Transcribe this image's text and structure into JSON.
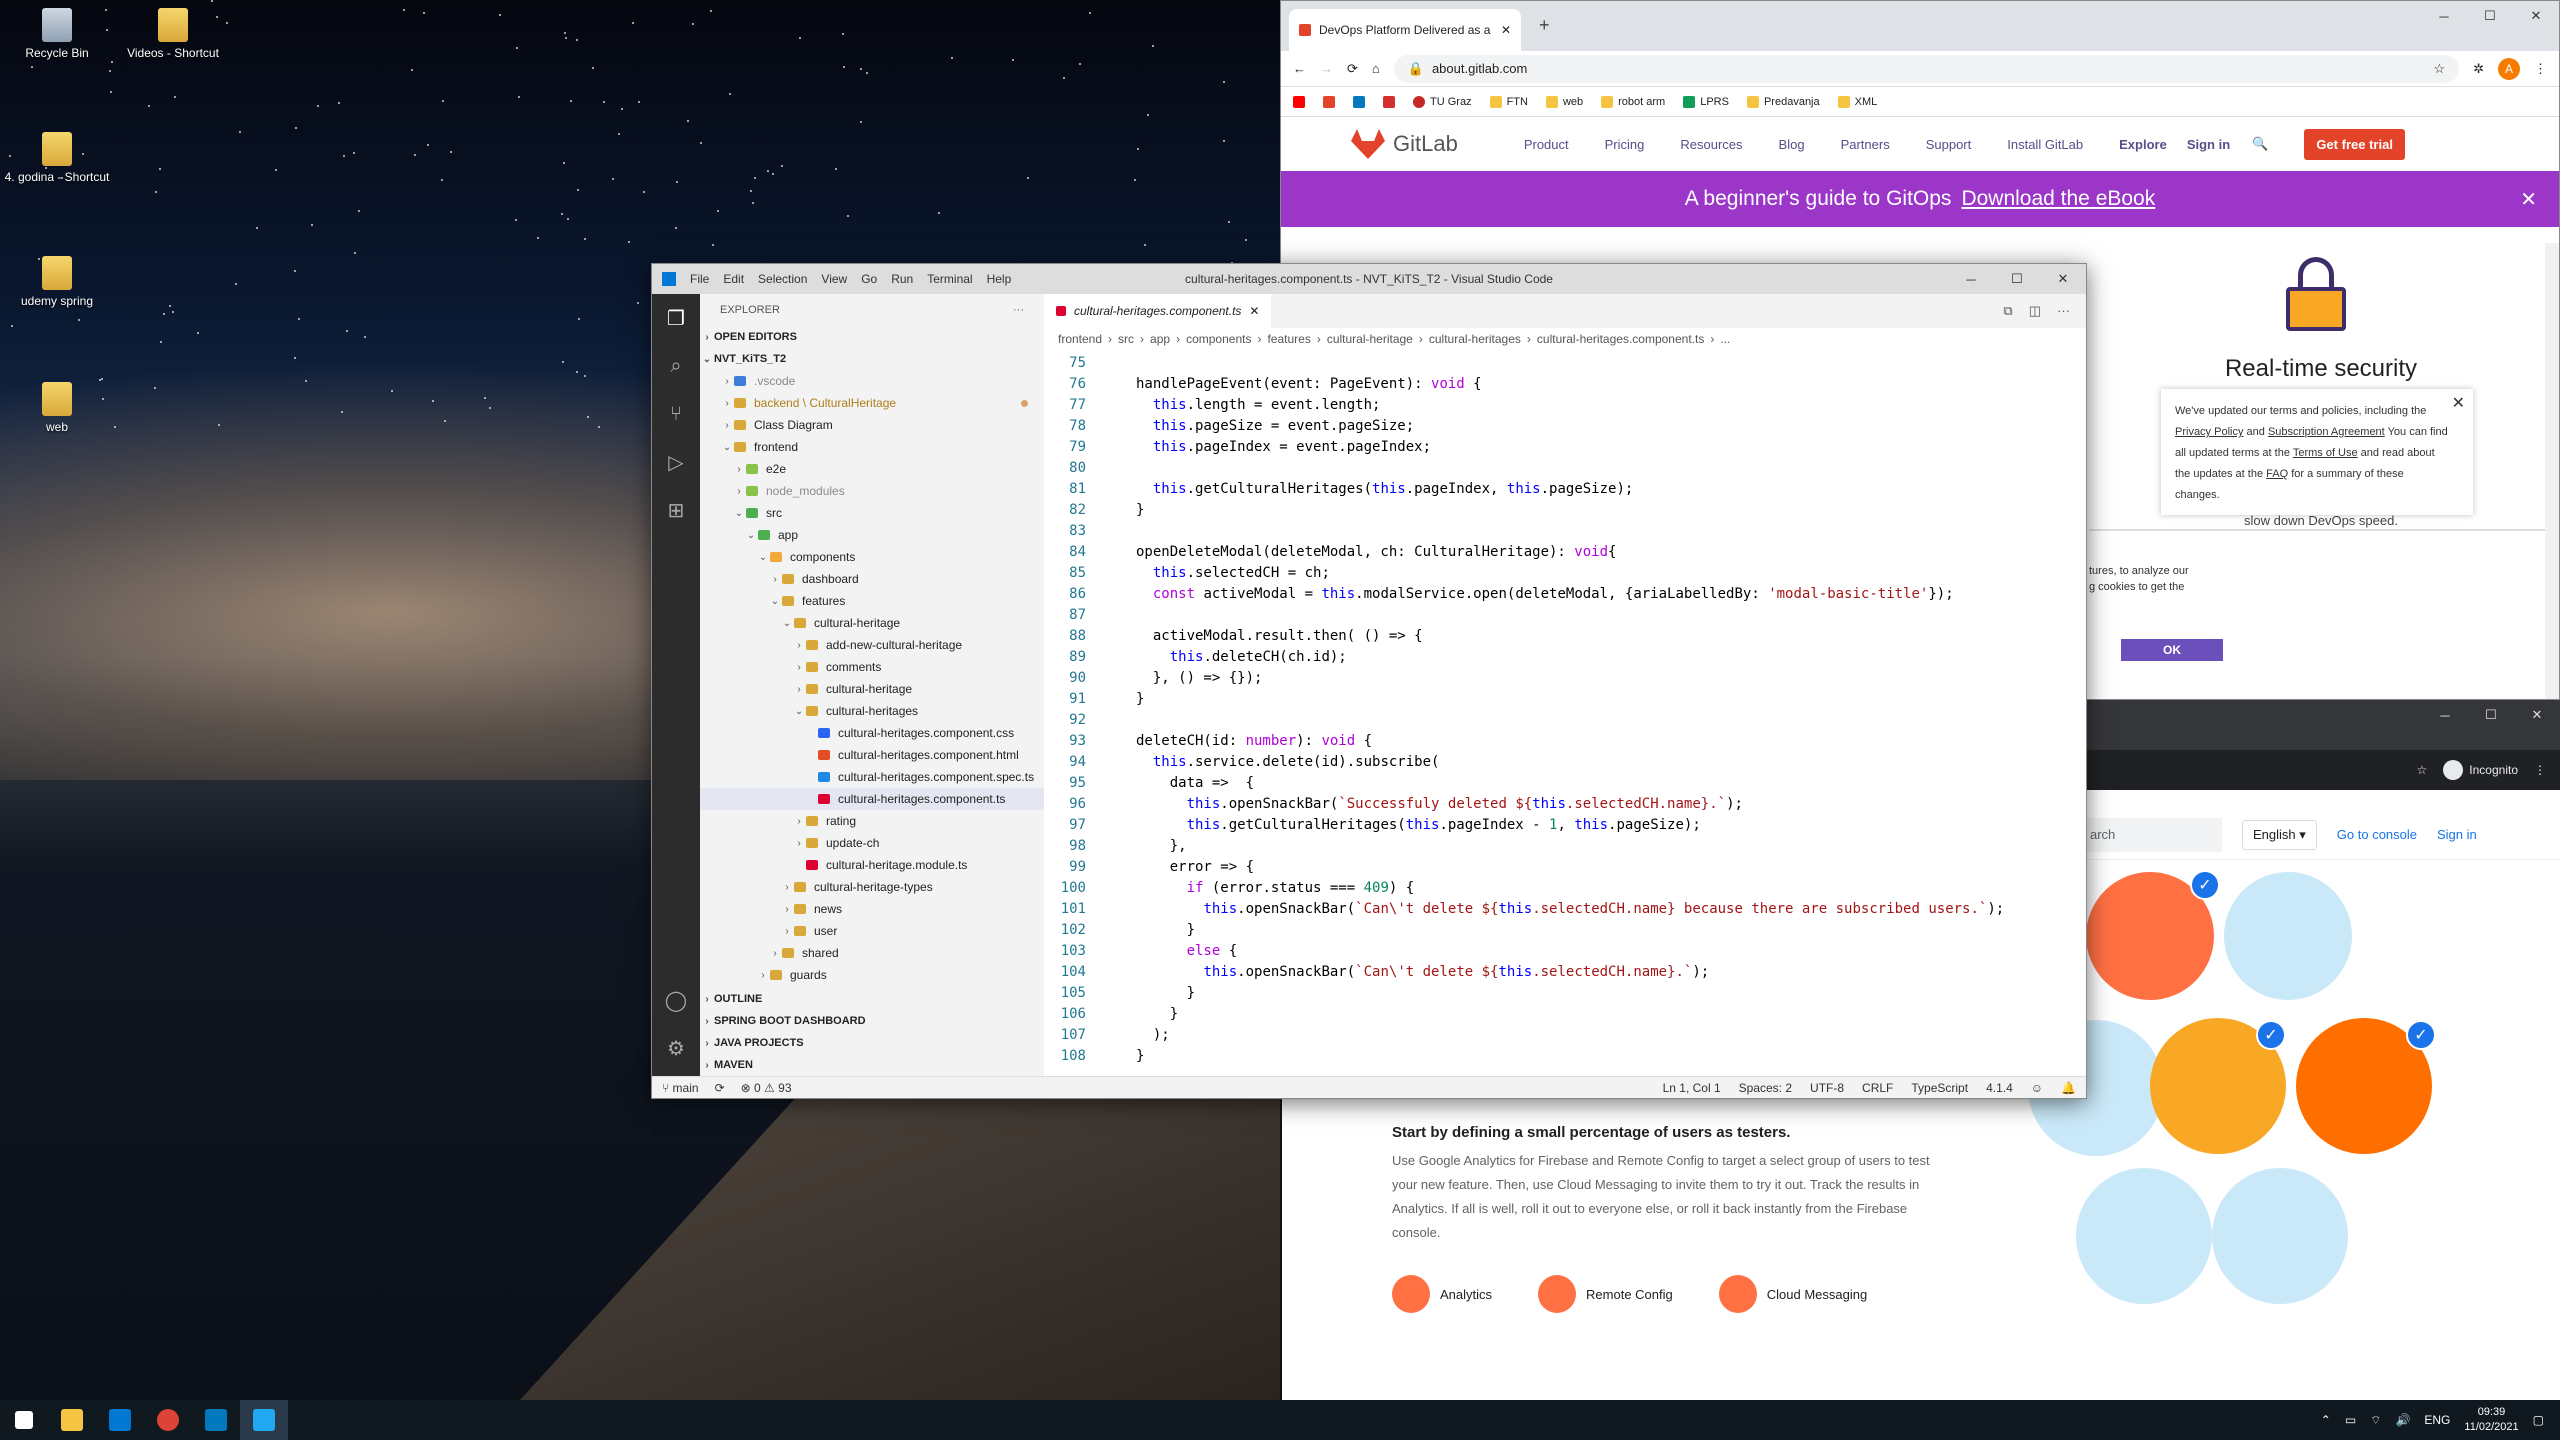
{
  "desktop": {
    "icons": [
      {
        "label": "Recycle Bin"
      },
      {
        "label": "Videos - Shortcut"
      },
      {
        "label": "4. godina - Shortcut"
      },
      {
        "label": "udemy spring"
      },
      {
        "label": "web"
      }
    ]
  },
  "gitlab_browser": {
    "tab_title": "DevOps Platform Delivered as a",
    "url": "about.gitlab.com",
    "bookmarks": [
      "TU Graz",
      "FTN",
      "web",
      "robot arm",
      "LPRS",
      "Predavanja",
      "XML"
    ],
    "profile_initial": "A",
    "nav": {
      "logo": "GitLab",
      "items": [
        "Product",
        "Pricing",
        "Resources",
        "Blog",
        "Partners",
        "Support",
        "Install GitLab",
        "Explore",
        "Sign in"
      ],
      "cta": "Get free trial"
    },
    "banner": {
      "text": "A beginner's guide to GitOps",
      "link": "Download the eBook"
    },
    "feature_title": "Real-time security",
    "cookie": {
      "p1": "We've updated our terms and policies, including the ",
      "privacy": "Privacy Policy",
      "and": " and ",
      "sub": "Subscription Agreement",
      "p2": " You can find all updated terms at the ",
      "terms": "Terms of Use",
      "p3": " and read about the updates at the ",
      "faq": "FAQ",
      "p4": " for a summary of these changes."
    },
    "partial": "slow down DevOps speed.",
    "consent_text1": "tures, to analyze our",
    "consent_text2": "g cookies to get the",
    "ok": "OK"
  },
  "firebase_browser": {
    "incognito": "Incognito",
    "search_placeholder": "arch",
    "language": "English",
    "console": "Go to console",
    "signin": "Sign in",
    "heading": "Start by defining a small percentage of users as testers.",
    "body": "Use Google Analytics for Firebase and Remote Config to target a select group of users to test your new feature. Then, use Cloud Messaging to invite them to try it out. Track the results in Analytics. If all is well, roll it out to everyone else, or roll it back instantly from the Firebase console.",
    "features": [
      "Analytics",
      "Remote Config",
      "Cloud Messaging"
    ]
  },
  "vscode": {
    "menu": [
      "File",
      "Edit",
      "Selection",
      "View",
      "Go",
      "Run",
      "Terminal",
      "Help"
    ],
    "title": "cultural-heritages.component.ts - NVT_KiTS_T2 - Visual Studio Code",
    "explorer_label": "EXPLORER",
    "open_editors": "OPEN EDITORS",
    "project": "NVT_KiTS_T2",
    "tree": [
      {
        "label": ".vscode",
        "depth": 1,
        "icon": "#3b7dd8",
        "chev": ">",
        "dim": true
      },
      {
        "label": "backend \\ CulturalHeritage",
        "depth": 1,
        "icon": "#d9a83a",
        "chev": ">",
        "mod": true
      },
      {
        "label": "Class Diagram",
        "depth": 1,
        "icon": "#d9a83a",
        "chev": ">"
      },
      {
        "label": "frontend",
        "depth": 1,
        "icon": "#d9a83a",
        "chev": "v"
      },
      {
        "label": "e2e",
        "depth": 2,
        "icon": "#8bc34a",
        "chev": ">"
      },
      {
        "label": "node_modules",
        "depth": 2,
        "icon": "#8bc34a",
        "chev": ">",
        "dim": true
      },
      {
        "label": "src",
        "depth": 2,
        "icon": "#4caf50",
        "chev": "v"
      },
      {
        "label": "app",
        "depth": 3,
        "icon": "#4caf50",
        "chev": "v"
      },
      {
        "label": "components",
        "depth": 4,
        "icon": "#f2a93b",
        "chev": "v"
      },
      {
        "label": "dashboard",
        "depth": 5,
        "icon": "#d9a83a",
        "chev": ">"
      },
      {
        "label": "features",
        "depth": 5,
        "icon": "#d9a83a",
        "chev": "v"
      },
      {
        "label": "cultural-heritage",
        "depth": 6,
        "icon": "#d9a83a",
        "chev": "v"
      },
      {
        "label": "add-new-cultural-heritage",
        "depth": 7,
        "icon": "#d9a83a",
        "chev": ">"
      },
      {
        "label": "comments",
        "depth": 7,
        "icon": "#d9a83a",
        "chev": ">"
      },
      {
        "label": "cultural-heritage",
        "depth": 7,
        "icon": "#d9a83a",
        "chev": ">"
      },
      {
        "label": "cultural-heritages",
        "depth": 7,
        "icon": "#d9a83a",
        "chev": "v"
      },
      {
        "label": "cultural-heritages.component.css",
        "depth": 8,
        "icon": "#2965f1",
        "chev": ""
      },
      {
        "label": "cultural-heritages.component.html",
        "depth": 8,
        "icon": "#e44d26",
        "chev": ""
      },
      {
        "label": "cultural-heritages.component.spec.ts",
        "depth": 8,
        "icon": "#1e88e5",
        "chev": ""
      },
      {
        "label": "cultural-heritages.component.ts",
        "depth": 8,
        "icon": "#dd0031",
        "chev": "",
        "sel": true
      },
      {
        "label": "rating",
        "depth": 7,
        "icon": "#d9a83a",
        "chev": ">"
      },
      {
        "label": "update-ch",
        "depth": 7,
        "icon": "#d9a83a",
        "chev": ">"
      },
      {
        "label": "cultural-heritage.module.ts",
        "depth": 7,
        "icon": "#dd0031",
        "chev": ""
      },
      {
        "label": "cultural-heritage-types",
        "depth": 6,
        "icon": "#d9a83a",
        "chev": ">"
      },
      {
        "label": "news",
        "depth": 6,
        "icon": "#d9a83a",
        "chev": ">"
      },
      {
        "label": "user",
        "depth": 6,
        "icon": "#d9a83a",
        "chev": ">"
      },
      {
        "label": "shared",
        "depth": 5,
        "icon": "#d9a83a",
        "chev": ">"
      },
      {
        "label": "guards",
        "depth": 4,
        "icon": "#d9a83a",
        "chev": ">"
      }
    ],
    "sections": [
      "OUTLINE",
      "SPRING BOOT DASHBOARD",
      "JAVA PROJECTS",
      "MAVEN"
    ],
    "tab": "cultural-heritages.component.ts",
    "breadcrumb": [
      "frontend",
      "src",
      "app",
      "components",
      "features",
      "cultural-heritage",
      "cultural-heritages",
      "cultural-heritages.component.ts",
      "..."
    ],
    "code": [
      {
        "n": "75",
        "t": ""
      },
      {
        "n": "76",
        "t": "handlePageEvent(event: PageEvent): void {"
      },
      {
        "n": "77",
        "t": "  this.length = event.length;"
      },
      {
        "n": "78",
        "t": "  this.pageSize = event.pageSize;"
      },
      {
        "n": "79",
        "t": "  this.pageIndex = event.pageIndex;"
      },
      {
        "n": "80",
        "t": ""
      },
      {
        "n": "81",
        "t": "  this.getCulturalHeritages(this.pageIndex, this.pageSize);"
      },
      {
        "n": "82",
        "t": "}"
      },
      {
        "n": "83",
        "t": ""
      },
      {
        "n": "84",
        "t": "openDeleteModal(deleteModal, ch: CulturalHeritage): void{"
      },
      {
        "n": "85",
        "t": "  this.selectedCH = ch;"
      },
      {
        "n": "86",
        "t": "  const activeModal = this.modalService.open(deleteModal, {ariaLabelledBy: 'modal-basic-title'});"
      },
      {
        "n": "87",
        "t": ""
      },
      {
        "n": "88",
        "t": "  activeModal.result.then( () => {"
      },
      {
        "n": "89",
        "t": "    this.deleteCH(ch.id);"
      },
      {
        "n": "90",
        "t": "  }, () => {});"
      },
      {
        "n": "91",
        "t": "}"
      },
      {
        "n": "92",
        "t": ""
      },
      {
        "n": "93",
        "t": "deleteCH(id: number): void {"
      },
      {
        "n": "94",
        "t": "  this.service.delete(id).subscribe("
      },
      {
        "n": "95",
        "t": "    data =>  {"
      },
      {
        "n": "96",
        "t": "      this.openSnackBar(`Successfuly deleted ${this.selectedCH.name}.`);"
      },
      {
        "n": "97",
        "t": "      this.getCulturalHeritages(this.pageIndex - 1, this.pageSize);"
      },
      {
        "n": "98",
        "t": "    },"
      },
      {
        "n": "99",
        "t": "    error => {"
      },
      {
        "n": "100",
        "t": "      if (error.status === 409) {"
      },
      {
        "n": "101",
        "t": "        this.openSnackBar(`Can\\'t delete ${this.selectedCH.name} because there are subscribed users.`);"
      },
      {
        "n": "102",
        "t": "      }"
      },
      {
        "n": "103",
        "t": "      else {"
      },
      {
        "n": "104",
        "t": "        this.openSnackBar(`Can\\'t delete ${this.selectedCH.name}.`);"
      },
      {
        "n": "105",
        "t": "      }"
      },
      {
        "n": "106",
        "t": "    }"
      },
      {
        "n": "107",
        "t": "  );"
      },
      {
        "n": "108",
        "t": "}"
      }
    ],
    "status": {
      "branch": "main",
      "problems": "0",
      "warnings": "93",
      "position": "Ln 1, Col 1",
      "spaces": "Spaces: 2",
      "encoding": "UTF-8",
      "eol": "CRLF",
      "lang": "TypeScript",
      "version": "4.1.4"
    }
  },
  "taskbar": {
    "lang": "ENG",
    "time": "09:39",
    "date": "11/02/2021"
  },
  "colors": {
    "gitlab_banner": "#9b36c8",
    "gitlab_cta": "#e24329",
    "vscode_activity": "#2c2c2c",
    "taskbar": "#101820"
  }
}
